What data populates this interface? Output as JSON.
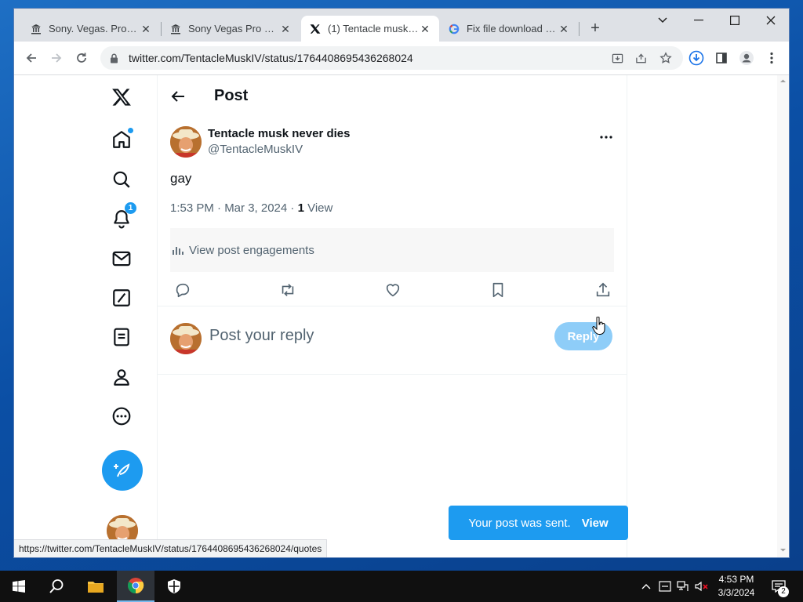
{
  "browser": {
    "tabs": [
      {
        "title": "Sony. Vegas. Pro 12.",
        "favicon": "bank-icon"
      },
      {
        "title": "Sony Vegas Pro 14.0",
        "favicon": "bank-icon"
      },
      {
        "title": "(1) Tentacle musk ne",
        "favicon": "x-logo-icon"
      },
      {
        "title": "Fix file download err",
        "favicon": "google-icon"
      }
    ],
    "url": "twitter.com/TentacleMuskIV/status/1764408695436268024",
    "status_url": "https://twitter.com/TentacleMuskIV/status/1764408695436268024/quotes"
  },
  "nav": {
    "notification_count": "1"
  },
  "post": {
    "header_title": "Post",
    "author_name": "Tentacle musk never dies",
    "author_handle": "@TentacleMuskIV",
    "text": "gay",
    "timestamp": "1:53 PM · Mar 3, 2024 · ",
    "views_count": "1",
    "views_label": " View",
    "engagements_label": "View post engagements"
  },
  "reply": {
    "placeholder": "Post your reply",
    "button_label": "Reply"
  },
  "toast": {
    "message": "Your post was sent.",
    "action": "View"
  },
  "taskbar": {
    "time": "4:53 PM",
    "date": "3/3/2024",
    "notification_count": "2"
  },
  "colors": {
    "accent": "#1d9bf0",
    "reply_disabled": "#8ecdf8",
    "taskbar": "#101010"
  }
}
